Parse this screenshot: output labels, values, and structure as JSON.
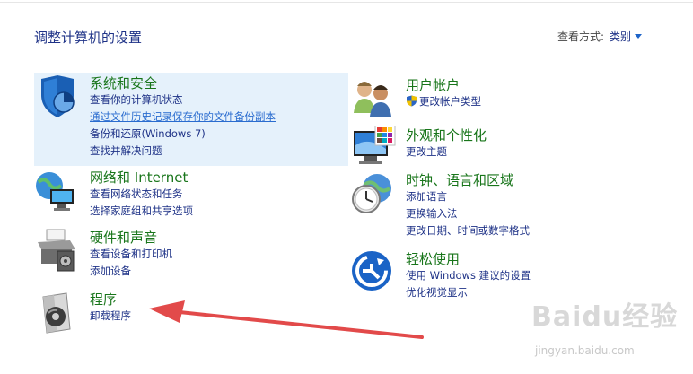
{
  "page": {
    "title": "调整计算机的设置"
  },
  "view_by": {
    "label": "查看方式:",
    "value": "类别"
  },
  "categories": {
    "system_security": {
      "title": "系统和安全",
      "links": [
        "查看你的计算机状态",
        "通过文件历史记录保存你的文件备份副本",
        "备份和还原(Windows 7)",
        "查找并解决问题"
      ]
    },
    "network": {
      "title": "网络和 Internet",
      "links": [
        "查看网络状态和任务",
        "选择家庭组和共享选项"
      ]
    },
    "hardware": {
      "title": "硬件和声音",
      "links": [
        "查看设备和打印机",
        "添加设备"
      ]
    },
    "programs": {
      "title": "程序",
      "links": [
        "卸载程序"
      ]
    },
    "accounts": {
      "title": "用户帐户",
      "links": [
        "更改帐户类型"
      ]
    },
    "appearance": {
      "title": "外观和个性化",
      "links": [
        "更改主题"
      ]
    },
    "clock": {
      "title": "时钟、语言和区域",
      "links": [
        "添加语言",
        "更换输入法",
        "更改日期、时间或数字格式"
      ]
    },
    "ease": {
      "title": "轻松使用",
      "links": [
        "使用 Windows 建议的设置",
        "优化视觉显示"
      ]
    }
  },
  "watermark": {
    "logo": "Baidu经验",
    "url": "jingyan.baidu.com"
  },
  "icons": {
    "system_security": "shield-icon",
    "network": "network-globe-icon",
    "hardware": "printer-icon",
    "programs": "programs-disc-icon",
    "accounts": "users-icon",
    "appearance": "monitor-palette-icon",
    "clock": "clock-globe-icon",
    "ease": "ease-of-access-icon"
  },
  "colors": {
    "category_title": "#18751a",
    "link": "#1e3287",
    "highlight": "#e5f1fb",
    "arrow": "#e24a4a"
  }
}
